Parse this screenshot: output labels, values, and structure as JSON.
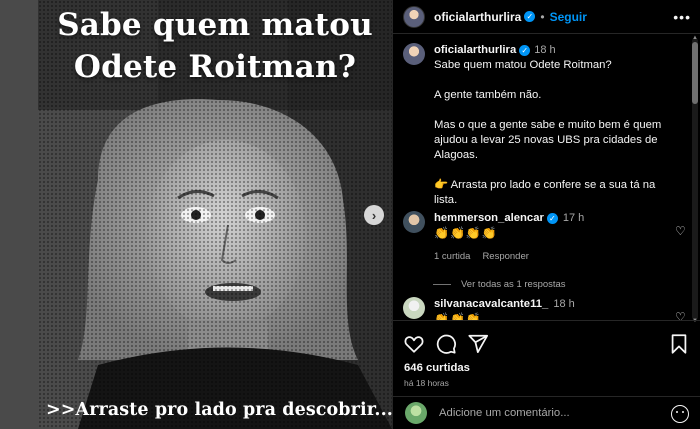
{
  "post": {
    "title_line1": "Sabe quem matou",
    "title_line2": "Odete Roitman?",
    "cta": ">>Arraste pro lado pra descobrir...",
    "next_icon": "chevron-right-icon"
  },
  "header": {
    "username": "oficialarthurlira",
    "follow_label": "Seguir",
    "more_icon": "more-horizontal-icon"
  },
  "caption": {
    "username": "oficialarthurlira",
    "time": "18 h",
    "line1": "Sabe quem matou Odete Roitman?",
    "line2": "A gente também não.",
    "line3": "Mas o que a gente sabe e muito bem é quem ajudou a levar 25 novas UBS pra cidades de Alagoas.",
    "line4": "👉 Arrasta pro lado e confere se a sua tá na lista."
  },
  "comments": [
    {
      "username": "hemmerson_alencar",
      "time": "17 h",
      "text": "👏👏👏👏",
      "likes": "1 curtida",
      "reply_label": "Responder",
      "view_replies": "Ver todas as 1 respostas"
    },
    {
      "username": "silvanacavalcante11_",
      "time": "18 h",
      "text": "👏👏👏"
    }
  ],
  "actions": {
    "likes": "646 curtidas",
    "posted": "há 18 horas"
  },
  "add_comment": {
    "placeholder": "Adicione um comentário..."
  }
}
